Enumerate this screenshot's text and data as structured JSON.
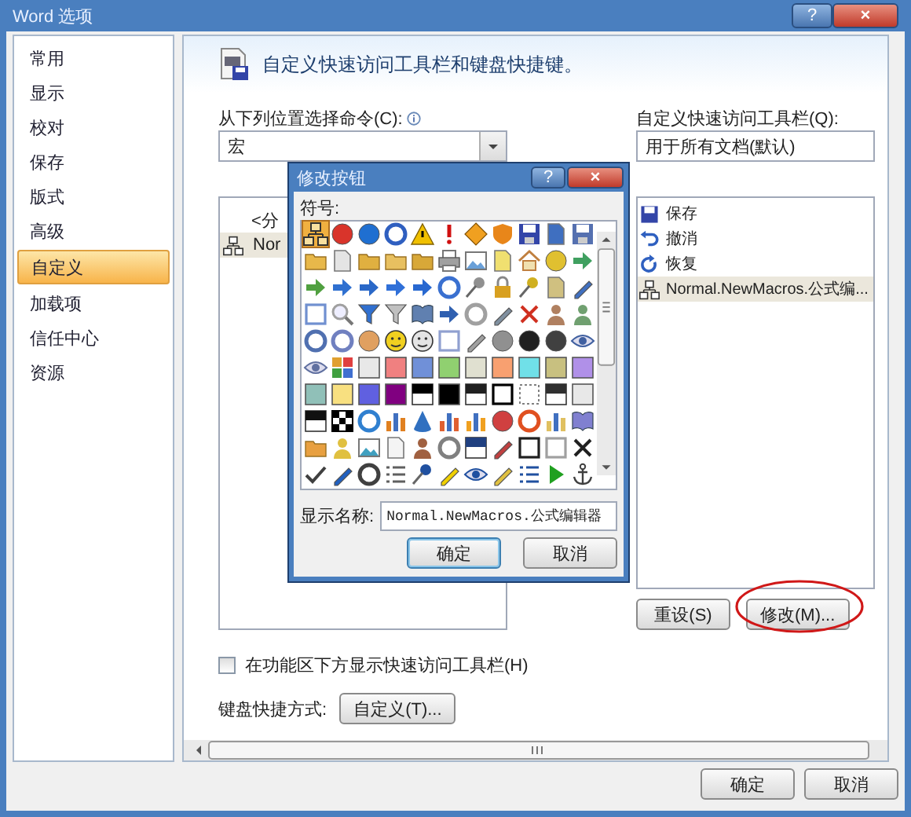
{
  "window": {
    "title": "Word 选项",
    "help_button": "?",
    "close_button": "×"
  },
  "sidebar": {
    "items": [
      {
        "label": "常用",
        "selected": false
      },
      {
        "label": "显示",
        "selected": false
      },
      {
        "label": "校对",
        "selected": false
      },
      {
        "label": "保存",
        "selected": false
      },
      {
        "label": "版式",
        "selected": false
      },
      {
        "label": "高级",
        "selected": false
      },
      {
        "label": "自定义",
        "selected": true
      },
      {
        "label": "加载项",
        "selected": false
      },
      {
        "label": "信任中心",
        "selected": false
      },
      {
        "label": "资源",
        "selected": false
      }
    ]
  },
  "header": {
    "title": "自定义快速访问工具栏和键盘快捷键。"
  },
  "commands": {
    "label": "从下列位置选择命令(C):",
    "dropdown": "宏",
    "items": [
      {
        "label": "<分",
        "kind": "separator",
        "selected": false
      },
      {
        "label": "Nor",
        "kind": "macro",
        "selected": true
      }
    ]
  },
  "toolbar": {
    "label": "自定义快速访问工具栏(Q):",
    "dropdown": "用于所有文档(默认)",
    "items": [
      {
        "label": "保存",
        "kind": "disk",
        "selected": false
      },
      {
        "label": "撤消",
        "kind": "undo",
        "selected": false
      },
      {
        "label": "恢复",
        "kind": "redo",
        "selected": false
      },
      {
        "label": "Normal.NewMacros.公式编...",
        "kind": "macro",
        "selected": true
      }
    ],
    "buttons": [
      "重设(S)",
      "修改(M)..."
    ]
  },
  "show_below_ribbon": {
    "label": "在功能区下方显示快速访问工具栏(H)",
    "checked": false
  },
  "keyboard": {
    "label": "键盘快捷方式:",
    "button": "自定义(T)..."
  },
  "footer_buttons": [
    "确定",
    "取消"
  ],
  "dialog": {
    "title": "修改按钮",
    "help_button": "?",
    "close_button": "×",
    "symbols_label": "符号:",
    "symbols": [
      {
        "kind": "org",
        "color": "#f8e0a0",
        "selected": true
      },
      {
        "kind": "circle",
        "color": "#d9342b",
        "selected": false
      },
      {
        "kind": "circle",
        "color": "#1f6fd1",
        "selected": false
      },
      {
        "kind": "ring",
        "color": "#2f5fc0",
        "selected": false
      },
      {
        "kind": "triangle",
        "color": "#f0c000",
        "selected": false
      },
      {
        "kind": "bang",
        "color": "#d01010",
        "selected": false
      },
      {
        "kind": "diamond",
        "color": "#f0a020",
        "selected": false
      },
      {
        "kind": "shield",
        "color": "#e8861a",
        "selected": false
      },
      {
        "kind": "disk",
        "color": "#3345a8",
        "selected": false
      },
      {
        "kind": "doc",
        "color": "#3f6fc0",
        "selected": false
      },
      {
        "kind": "disk",
        "color": "#5570b0",
        "selected": false
      },
      {
        "kind": "folder",
        "color": "#e8b84a",
        "selected": false
      },
      {
        "kind": "doc",
        "color": "#e4e4e4",
        "selected": false
      },
      {
        "kind": "folder",
        "color": "#e0b040",
        "selected": false
      },
      {
        "kind": "folder",
        "color": "#e8c060",
        "selected": false
      },
      {
        "kind": "folder",
        "color": "#d8a838",
        "selected": false
      },
      {
        "kind": "printer",
        "color": "#a0a0a0",
        "selected": false
      },
      {
        "kind": "picture",
        "color": "#6aa0d8",
        "selected": false
      },
      {
        "kind": "doc",
        "color": "#f0e070",
        "selected": false
      },
      {
        "kind": "house",
        "color": "#c08040",
        "selected": false
      },
      {
        "kind": "circle",
        "color": "#e0c030",
        "selected": false
      },
      {
        "kind": "arrow",
        "color": "#40a060",
        "selected": false
      },
      {
        "kind": "arrow",
        "color": "#50a040",
        "selected": false
      },
      {
        "kind": "arrow",
        "color": "#2f70d0",
        "selected": false
      },
      {
        "kind": "arrow",
        "color": "#2a68c8",
        "selected": false
      },
      {
        "kind": "arrow",
        "color": "#3070d8",
        "selected": false
      },
      {
        "kind": "arrow",
        "color": "#2868d0",
        "selected": false
      },
      {
        "kind": "ring",
        "color": "#3a70d0",
        "selected": false
      },
      {
        "kind": "pin",
        "color": "#909090",
        "selected": false
      },
      {
        "kind": "lock",
        "color": "#d8a020",
        "selected": false
      },
      {
        "kind": "pin",
        "color": "#d0b020",
        "selected": false
      },
      {
        "kind": "doc",
        "color": "#d0c080",
        "selected": false
      },
      {
        "kind": "pen",
        "color": "#4070c0",
        "selected": false
      },
      {
        "kind": "frame",
        "color": "#7090d0",
        "selected": false
      },
      {
        "kind": "lens",
        "color": "#a0a0a0",
        "selected": false
      },
      {
        "kind": "funnel",
        "color": "#3070d0",
        "selected": false
      },
      {
        "kind": "funnel",
        "color": "#c0c0c0",
        "selected": false
      },
      {
        "kind": "book",
        "color": "#6080b0",
        "selected": false
      },
      {
        "kind": "arrow",
        "color": "#3060b0",
        "selected": false
      },
      {
        "kind": "ring",
        "color": "#a0a0a0",
        "selected": false
      },
      {
        "kind": "pen",
        "color": "#8090a0",
        "selected": false
      },
      {
        "kind": "cross",
        "color": "#d03020",
        "selected": false
      },
      {
        "kind": "person",
        "color": "#b08060",
        "selected": false
      },
      {
        "kind": "person",
        "color": "#70a070",
        "selected": false
      },
      {
        "kind": "ring",
        "color": "#5070b0",
        "selected": false
      },
      {
        "kind": "ring",
        "color": "#7080c0",
        "selected": false
      },
      {
        "kind": "circle",
        "color": "#e0a060",
        "selected": false
      },
      {
        "kind": "face",
        "color": "#f0d020",
        "selected": false
      },
      {
        "kind": "face",
        "color": "#e4e4e4",
        "selected": false
      },
      {
        "kind": "frame",
        "color": "#90a0d0",
        "selected": false
      },
      {
        "kind": "pen",
        "color": "#a0a0a0",
        "selected": false
      },
      {
        "kind": "circle",
        "color": "#909090",
        "selected": false
      },
      {
        "kind": "circle",
        "color": "#202020",
        "selected": false
      },
      {
        "kind": "circle",
        "color": "#404040",
        "selected": false
      },
      {
        "kind": "eye",
        "color": "#4060a0",
        "selected": false
      },
      {
        "kind": "eye",
        "color": "#6070a0",
        "selected": false
      },
      {
        "kind": "tiles",
        "color": "#e0a030",
        "selected": false
      },
      {
        "kind": "swatch",
        "color": "#e8e8e8",
        "selected": false
      },
      {
        "kind": "swatch",
        "color": "#f08080",
        "selected": false
      },
      {
        "kind": "swatch",
        "color": "#7090d8",
        "selected": false
      },
      {
        "kind": "swatch",
        "color": "#90d070",
        "selected": false
      },
      {
        "kind": "swatch",
        "color": "#e0e0d0",
        "selected": false
      },
      {
        "kind": "swatch",
        "color": "#f8a070",
        "selected": false
      },
      {
        "kind": "swatch",
        "color": "#70e0e8",
        "selected": false
      },
      {
        "kind": "swatch",
        "color": "#c8c080",
        "selected": false
      },
      {
        "kind": "swatch",
        "color": "#b090e8",
        "selected": false
      },
      {
        "kind": "swatch",
        "color": "#90c0b8",
        "selected": false
      },
      {
        "kind": "swatch",
        "color": "#f8e080",
        "selected": false
      },
      {
        "kind": "swatch",
        "color": "#6060e0",
        "selected": false
      },
      {
        "kind": "swatch",
        "color": "#800080",
        "selected": false
      },
      {
        "kind": "half",
        "color": "#000000",
        "selected": false
      },
      {
        "kind": "swatch",
        "color": "#000000",
        "selected": false
      },
      {
        "kind": "half",
        "color": "#202020",
        "selected": false
      },
      {
        "kind": "frame",
        "color": "#000000",
        "selected": false
      },
      {
        "kind": "dotted",
        "color": "#808080",
        "selected": false
      },
      {
        "kind": "half",
        "color": "#303030",
        "selected": false
      },
      {
        "kind": "swatch",
        "color": "#e8e8e8",
        "selected": false
      },
      {
        "kind": "half",
        "color": "#101010",
        "selected": false
      },
      {
        "kind": "checker",
        "color": "#000000",
        "selected": false
      },
      {
        "kind": "ring",
        "color": "#3080d0",
        "selected": false
      },
      {
        "kind": "bars",
        "color": "#e08020",
        "selected": false
      },
      {
        "kind": "cone",
        "color": "#3070c0",
        "selected": false
      },
      {
        "kind": "bars",
        "color": "#e06030",
        "selected": false
      },
      {
        "kind": "bars",
        "color": "#f0a020",
        "selected": false
      },
      {
        "kind": "circle",
        "color": "#d04040",
        "selected": false
      },
      {
        "kind": "ring",
        "color": "#e05020",
        "selected": false
      },
      {
        "kind": "bars",
        "color": "#e0c060",
        "selected": false
      },
      {
        "kind": "book",
        "color": "#8080d0",
        "selected": false
      },
      {
        "kind": "folder",
        "color": "#e8a040",
        "selected": false
      },
      {
        "kind": "person",
        "color": "#e0c040",
        "selected": false
      },
      {
        "kind": "picture",
        "color": "#40a0c0",
        "selected": false
      },
      {
        "kind": "doc",
        "color": "#f4f4f4",
        "selected": false
      },
      {
        "kind": "person",
        "color": "#a06040",
        "selected": false
      },
      {
        "kind": "ring",
        "color": "#808080",
        "selected": false
      },
      {
        "kind": "half",
        "color": "#204080",
        "selected": false
      },
      {
        "kind": "pen",
        "color": "#c04040",
        "selected": false
      },
      {
        "kind": "frame",
        "color": "#202020",
        "selected": false
      },
      {
        "kind": "frame",
        "color": "#a0a0a0",
        "selected": false
      },
      {
        "kind": "cross",
        "color": "#202020",
        "selected": false
      },
      {
        "kind": "check",
        "color": "#404040",
        "selected": false
      },
      {
        "kind": "pen",
        "color": "#2060c0",
        "selected": false
      },
      {
        "kind": "ring",
        "color": "#404040",
        "selected": false
      },
      {
        "kind": "lines",
        "color": "#606060",
        "selected": false
      },
      {
        "kind": "pin",
        "color": "#2050a0",
        "selected": false
      },
      {
        "kind": "pen",
        "color": "#f0d000",
        "selected": false
      },
      {
        "kind": "eye",
        "color": "#2050a0",
        "selected": false
      },
      {
        "kind": "pen",
        "color": "#e0c040",
        "selected": false
      },
      {
        "kind": "lines",
        "color": "#2050a0",
        "selected": false
      },
      {
        "kind": "play",
        "color": "#20a020",
        "selected": false
      },
      {
        "kind": "anchor",
        "color": "#404040",
        "selected": false
      }
    ],
    "name_label": "显示名称:",
    "name_value": "Normal.NewMacros.公式编辑器",
    "buttons": [
      "确定",
      "取消"
    ]
  }
}
